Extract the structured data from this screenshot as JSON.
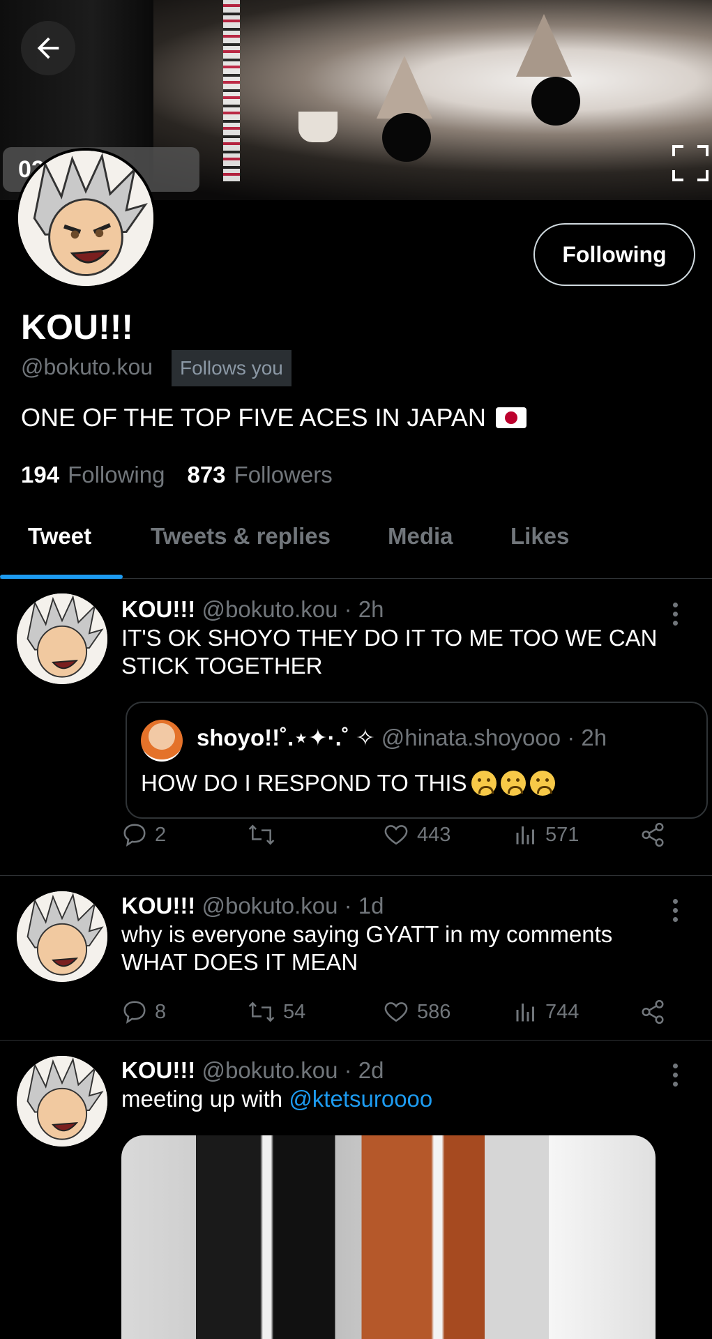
{
  "banner": {
    "timestamp_text": "02:__ AM"
  },
  "profile": {
    "display_name": "KOU!!!",
    "handle": "@bokuto.kou",
    "follows_you": "Follows you",
    "bio": "ONE OF THE TOP FIVE ACES IN JAPAN",
    "following_button": "Following",
    "following_count": "194",
    "following_label": "Following",
    "followers_count": "873",
    "followers_label": "Followers"
  },
  "tabs": [
    {
      "label": "Tweet",
      "active": true
    },
    {
      "label": "Tweets & replies",
      "active": false
    },
    {
      "label": "Media",
      "active": false
    },
    {
      "label": "Likes",
      "active": false
    }
  ],
  "tweets": [
    {
      "name": "KOU!!!",
      "meta": "@bokuto.kou · 2h",
      "text": "IT'S OK SHOYO THEY DO IT TO ME TOO WE CAN STICK TOGETHER",
      "quote": {
        "name": "shoyo!!˚.⋆✦·.˚ ✧",
        "meta": "@hinata.shoyooo · 2h",
        "text": "HOW DO I RESPOND TO THIS"
      },
      "replies": "2",
      "retweets": "",
      "likes": "443",
      "views": "571"
    },
    {
      "name": "KOU!!!",
      "meta": "@bokuto.kou · 1d",
      "text": "why is everyone saying GYATT in my comments WHAT DOES IT MEAN",
      "replies": "8",
      "retweets": "54",
      "likes": "586",
      "views": "744"
    },
    {
      "name": "KOU!!!",
      "meta": "@bokuto.kou · 2d",
      "text_prefix": "meeting up with ",
      "mention": "@ktetsuroooo"
    }
  ],
  "colors": {
    "accent": "#1d9bf0",
    "muted": "#71767b",
    "border": "#2f3336",
    "background": "#000000"
  },
  "icons": {
    "back": "arrow-left-icon",
    "expand": "fullscreen-icon",
    "more": "more-vertical-icon",
    "reply": "comment-icon",
    "retweet": "retweet-icon",
    "like": "heart-icon",
    "views": "bar-chart-icon",
    "share": "share-icon",
    "flag": "japan-flag-icon"
  }
}
